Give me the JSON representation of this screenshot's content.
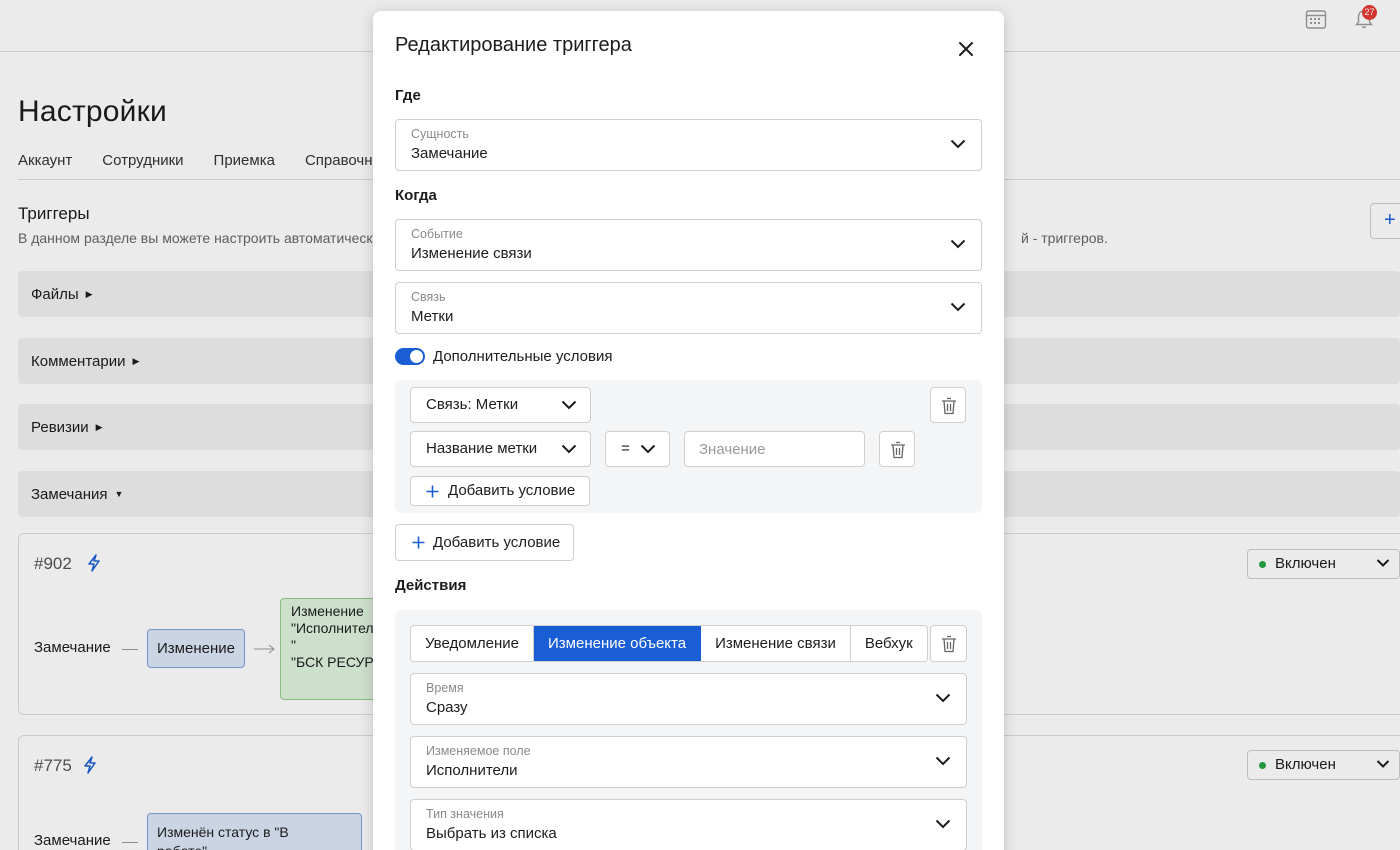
{
  "header": {
    "notification_count": "27",
    "icons": [
      "calendar-icon",
      "bell-icon"
    ]
  },
  "page": {
    "title": "Настройки",
    "tabs": [
      "Аккаунт",
      "Сотрудники",
      "Приемка",
      "Справочники"
    ],
    "section_title": "Триггеры",
    "section_desc_left": "В данном разделе вы можете настроить автоматические",
    "section_desc_right": "й - триггеров.",
    "add_button": "+",
    "accordions": [
      "Файлы",
      "Комментарии",
      "Ревизии",
      "Замечания"
    ]
  },
  "cards": [
    {
      "id": "#902",
      "entity": "Замечание",
      "event": "Изменение",
      "action_text": "Изменение \n\"Исполнители\n\"\n\"БСК РЕСУРС",
      "status": "Включен"
    },
    {
      "id": "#775",
      "entity": "Замечание",
      "event": "Изменён статус в \"В\nработе\"",
      "status": "Включен"
    }
  ],
  "modal": {
    "title": "Редактирование триггера",
    "where_label": "Где",
    "entity_caption": "Сущность",
    "entity_value": "Замечание",
    "when_label": "Когда",
    "event_caption": "Событие",
    "event_value": "Изменение связи",
    "link_caption": "Связь",
    "link_value": "Метки",
    "extra_conditions_label": "Дополнительные условия",
    "extra_conditions_enabled": true,
    "condition": {
      "relation_select": "Связь: Метки",
      "field_select": "Название метки",
      "operator_select": "=",
      "value_placeholder": "Значение",
      "add_inner_label": "Добавить условие"
    },
    "add_condition_label": "Добавить условие",
    "actions_label": "Действия",
    "action_tabs": [
      "Уведомление",
      "Изменение объекта",
      "Изменение связи",
      "Вебхук"
    ],
    "action_active_tab": "Изменение объекта",
    "time_caption": "Время",
    "time_value": "Сразу",
    "field_caption": "Изменяемое поле",
    "field_value": "Исполнители",
    "value_type_caption": "Тип значения",
    "value_type_value": "Выбрать из списка"
  },
  "colors": {
    "accent": "#1a5ed6",
    "status_on": "#26a544",
    "badge": "#e53935"
  }
}
